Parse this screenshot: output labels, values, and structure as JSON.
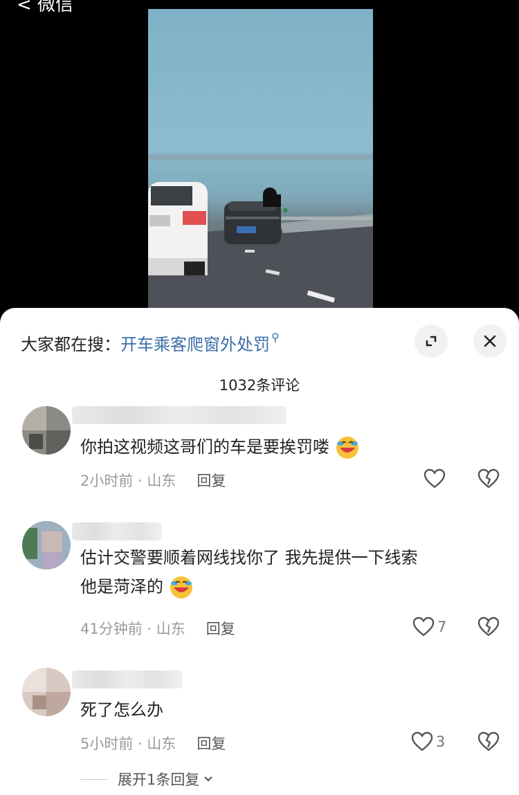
{
  "top_back_label": "< 微信",
  "video": {
    "alt": "video-frame"
  },
  "search": {
    "prefix": "大家都在搜：",
    "term": "开车乘客爬窗外处罚"
  },
  "comments_count": "1032条评论",
  "comments": [
    {
      "text": "你拍这视频这哥们的车是要挨罚喽",
      "time": "2小时前 · 山东",
      "reply": "回复",
      "likes": ""
    },
    {
      "text_line1": "估计交警要顺着网线找你了 我先提供一下线索",
      "text_line2": "他是菏泽的",
      "time": "41分钟前 · 山东",
      "reply": "回复",
      "likes": "7"
    },
    {
      "text": "死了怎么办",
      "time": "5小时前 · 山东",
      "reply": "回复",
      "likes": "3"
    }
  ],
  "expand_label": "展开1条回复",
  "icons": [
    "expand-icon",
    "close-icon",
    "heart-icon",
    "broken-heart-icon",
    "chevron-down-icon",
    "laugh-cry-emoji"
  ]
}
